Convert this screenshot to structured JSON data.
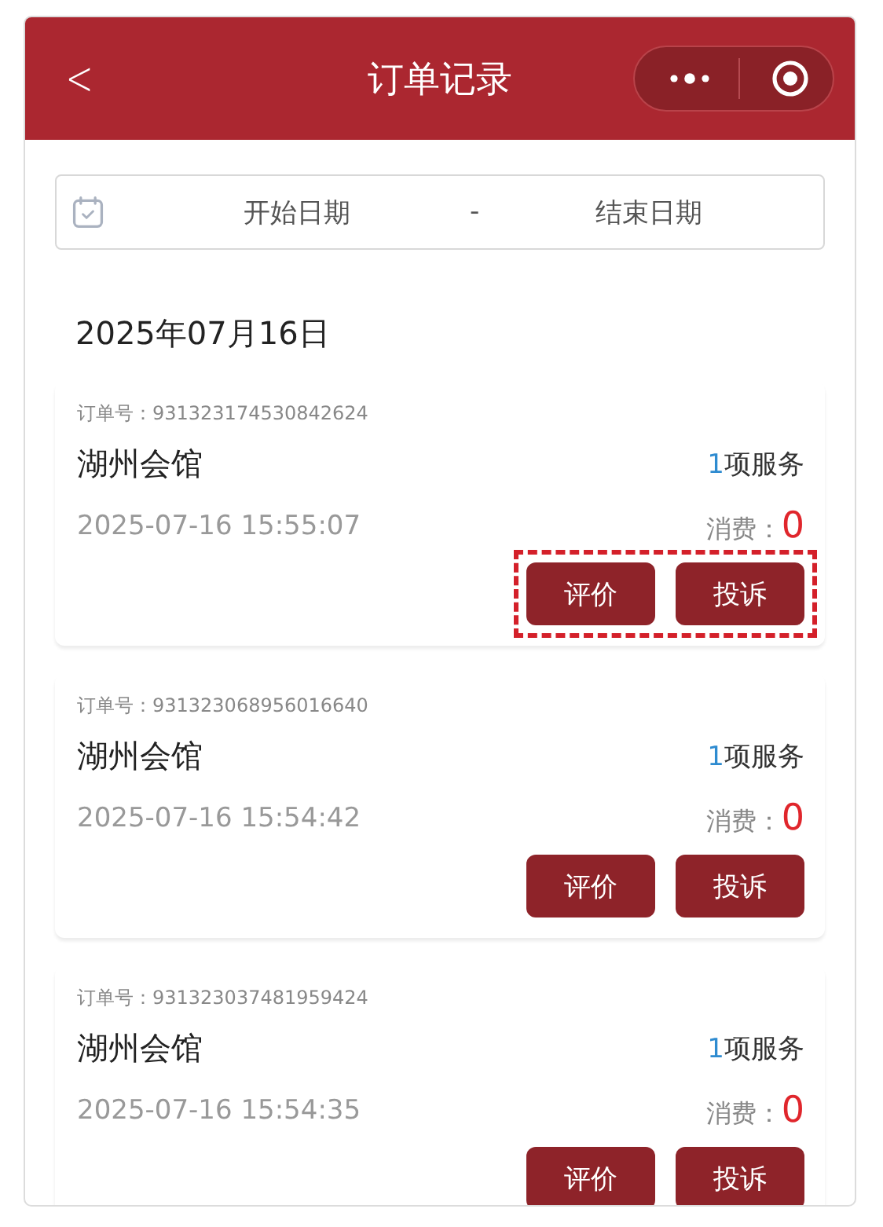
{
  "header": {
    "back": "<",
    "title": "订单记录"
  },
  "date_range": {
    "start_placeholder": "开始日期",
    "separator": "-",
    "end_placeholder": "结束日期"
  },
  "date_heading": "2025年07月16日",
  "orders": [
    {
      "order_label": "订单号：",
      "order_no": "931323174530842624",
      "venue": "湖州会馆",
      "service_count": "1",
      "service_label": "项服务",
      "time": "2025-07-16 15:55:07",
      "fee_label": "消费：",
      "fee": "0",
      "buttons": [
        "评价",
        "投诉"
      ],
      "highlighted": true
    },
    {
      "order_label": "订单号：",
      "order_no": "931323068956016640",
      "venue": "湖州会馆",
      "service_count": "1",
      "service_label": "项服务",
      "time": "2025-07-16 15:54:42",
      "fee_label": "消费：",
      "fee": "0",
      "buttons": [
        "评价",
        "投诉"
      ],
      "highlighted": false
    },
    {
      "order_label": "订单号：",
      "order_no": "931323037481959424",
      "venue": "湖州会馆",
      "service_count": "1",
      "service_label": "项服务",
      "time": "2025-07-16 15:54:35",
      "fee_label": "消费：",
      "fee": "0",
      "buttons": [
        "评价",
        "投诉"
      ],
      "highlighted": false
    }
  ]
}
